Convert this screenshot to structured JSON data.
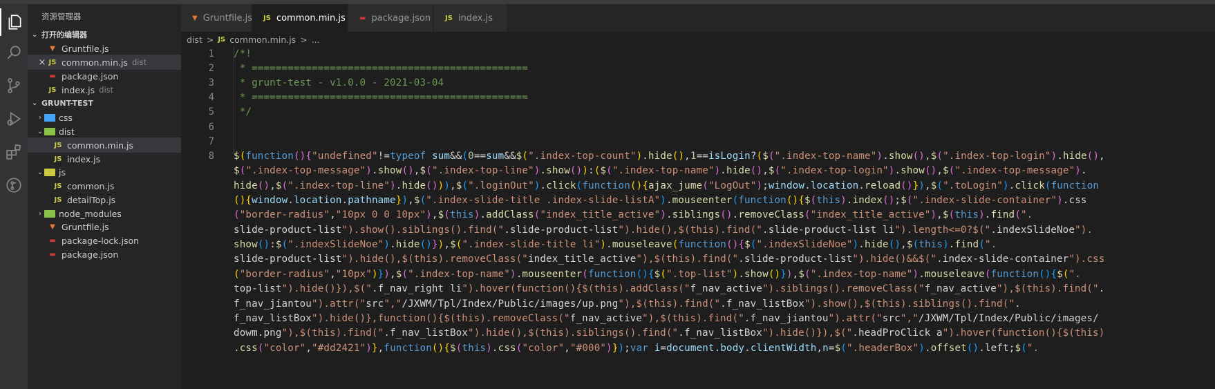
{
  "sidebar": {
    "title": "资源管理器",
    "open_editors_label": "打开的编辑器",
    "open_editors": [
      {
        "name": "Gruntfile.js",
        "desc": "",
        "icon": "grunt-icon"
      },
      {
        "name": "common.min.js",
        "desc": "dist",
        "icon": "js-icon"
      },
      {
        "name": "package.json",
        "desc": "",
        "icon": "json-icon"
      },
      {
        "name": "index.js",
        "desc": "dist",
        "icon": "js-icon"
      }
    ],
    "project_label": "GRUNT-TEST",
    "tree": [
      {
        "name": "css",
        "type": "folder",
        "color": "#42a5f5"
      },
      {
        "name": "dist",
        "type": "folder",
        "color": "#8bc34a"
      },
      {
        "name": "common.min.js",
        "type": "js"
      },
      {
        "name": "index.js",
        "type": "js"
      },
      {
        "name": "js",
        "type": "folder",
        "color": "#cbcb41"
      },
      {
        "name": "common.js",
        "type": "js"
      },
      {
        "name": "detailTop.js",
        "type": "js"
      },
      {
        "name": "node_modules",
        "type": "folder",
        "color": "#8bc34a"
      },
      {
        "name": "Gruntfile.js",
        "type": "grunt"
      },
      {
        "name": "package-lock.json",
        "type": "json"
      },
      {
        "name": "package.json",
        "type": "json"
      }
    ]
  },
  "tabs": [
    {
      "label": "Gruntfile.js",
      "icon": "grunt-icon"
    },
    {
      "label": "common.min.js",
      "icon": "js-icon",
      "close": "×"
    },
    {
      "label": "package.json",
      "icon": "json-icon"
    },
    {
      "label": "index.js",
      "icon": "js-icon"
    }
  ],
  "breadcrumb": {
    "folder": "dist",
    "sep": ">",
    "file": "common.min.js",
    "more": "..."
  },
  "editor": {
    "line_numbers": [
      "1",
      "2",
      "3",
      "4",
      "5",
      "6",
      "7",
      "8"
    ],
    "comment_lines": [
      "/*!",
      " * ==============================================",
      " * grunt-test - v1.0.0 - 2021-03-04",
      " * ==============================================",
      " */"
    ],
    "code_lines": [
      "$(function(){\"undefined\"!=typeof sum&&(0==sum&&$(\".index-top-count\").hide(),1==isLogin?($(\".index-top-name\").show(),$(\".index-top-login\").hide(),",
      "$(\".index-top-message\").show(),$(\".index-top-line\").show()):($(\".index-top-name\").hide(),$(\".index-top-login\").show(),$(\".index-top-message\").",
      "hide(),$(\".index-top-line\").hide())),$(\".loginOut\").click(function(){ajax_jume(\"LogOut\");window.location.reload()}),$(\".toLogin\").click(function",
      "(){window.location.pathname}),$(\".index-slide-title .index-slide-listA\").mouseenter(function(){$(this).index();$(\".index-slide-container\").css",
      "(\"border-radius\",\"10px 0 0 10px\"),$(this).addClass(\"index_title_active\").siblings().removeClass(\"index_title_active\"),$(this).find(\".",
      "slide-product-list\").show().siblings().find(\".slide-product-list\").hide(),$(this).find(\".slide-product-list li\").length<=0?$(\".indexSlideNoe\").",
      "show():$(\".indexSlideNoe\").hide()}),$(\".index-slide-title li\").mouseleave(function(){$(\".indexSlideNoe\").hide(),$(this).find(\".",
      "slide-product-list\").hide(),$(this).removeClass(\"index_title_active\"),$(this).find(\".slide-product-list\").hide()&&$(\".index-slide-container\").css",
      "(\"border-radius\",\"10px\")}),$(\".index-top-name\").mouseenter(function(){$(\".top-list\").show()}),$(\".index-top-name\").mouseleave(function(){$(\".",
      "top-list\").hide()}),$(\".f_nav_right li\").hover(function(){$(this).addClass(\"f_nav_active\").siblings().removeClass(\"f_nav_active\"),$(this).find(\".",
      "f_nav_jiantou\").attr(\"src\",\"/JXWM/Tpl/Index/Public/images/up.png\"),$(this).find(\".f_nav_listBox\").show(),$(this).siblings().find(\".",
      "f_nav_listBox\").hide()},function(){$(this).removeClass(\"f_nav_active\"),$(this).find(\".f_nav_jiantou\").attr(\"src\",\"/JXWM/Tpl/Index/Public/images/",
      "dowm.png\"),$(this).find(\".f_nav_listBox\").hide(),$(this).siblings().find(\".f_nav_listBox\").hide()}),$(\".headProClick a\").hover(function(){$(this)",
      ".css(\"color\",\"#dd2421\")},function(){$(this).css(\"color\",\"#000\")});var i=document.body.clientWidth,n=$(\".headerBox\").offset().left;$(\"."
    ]
  }
}
